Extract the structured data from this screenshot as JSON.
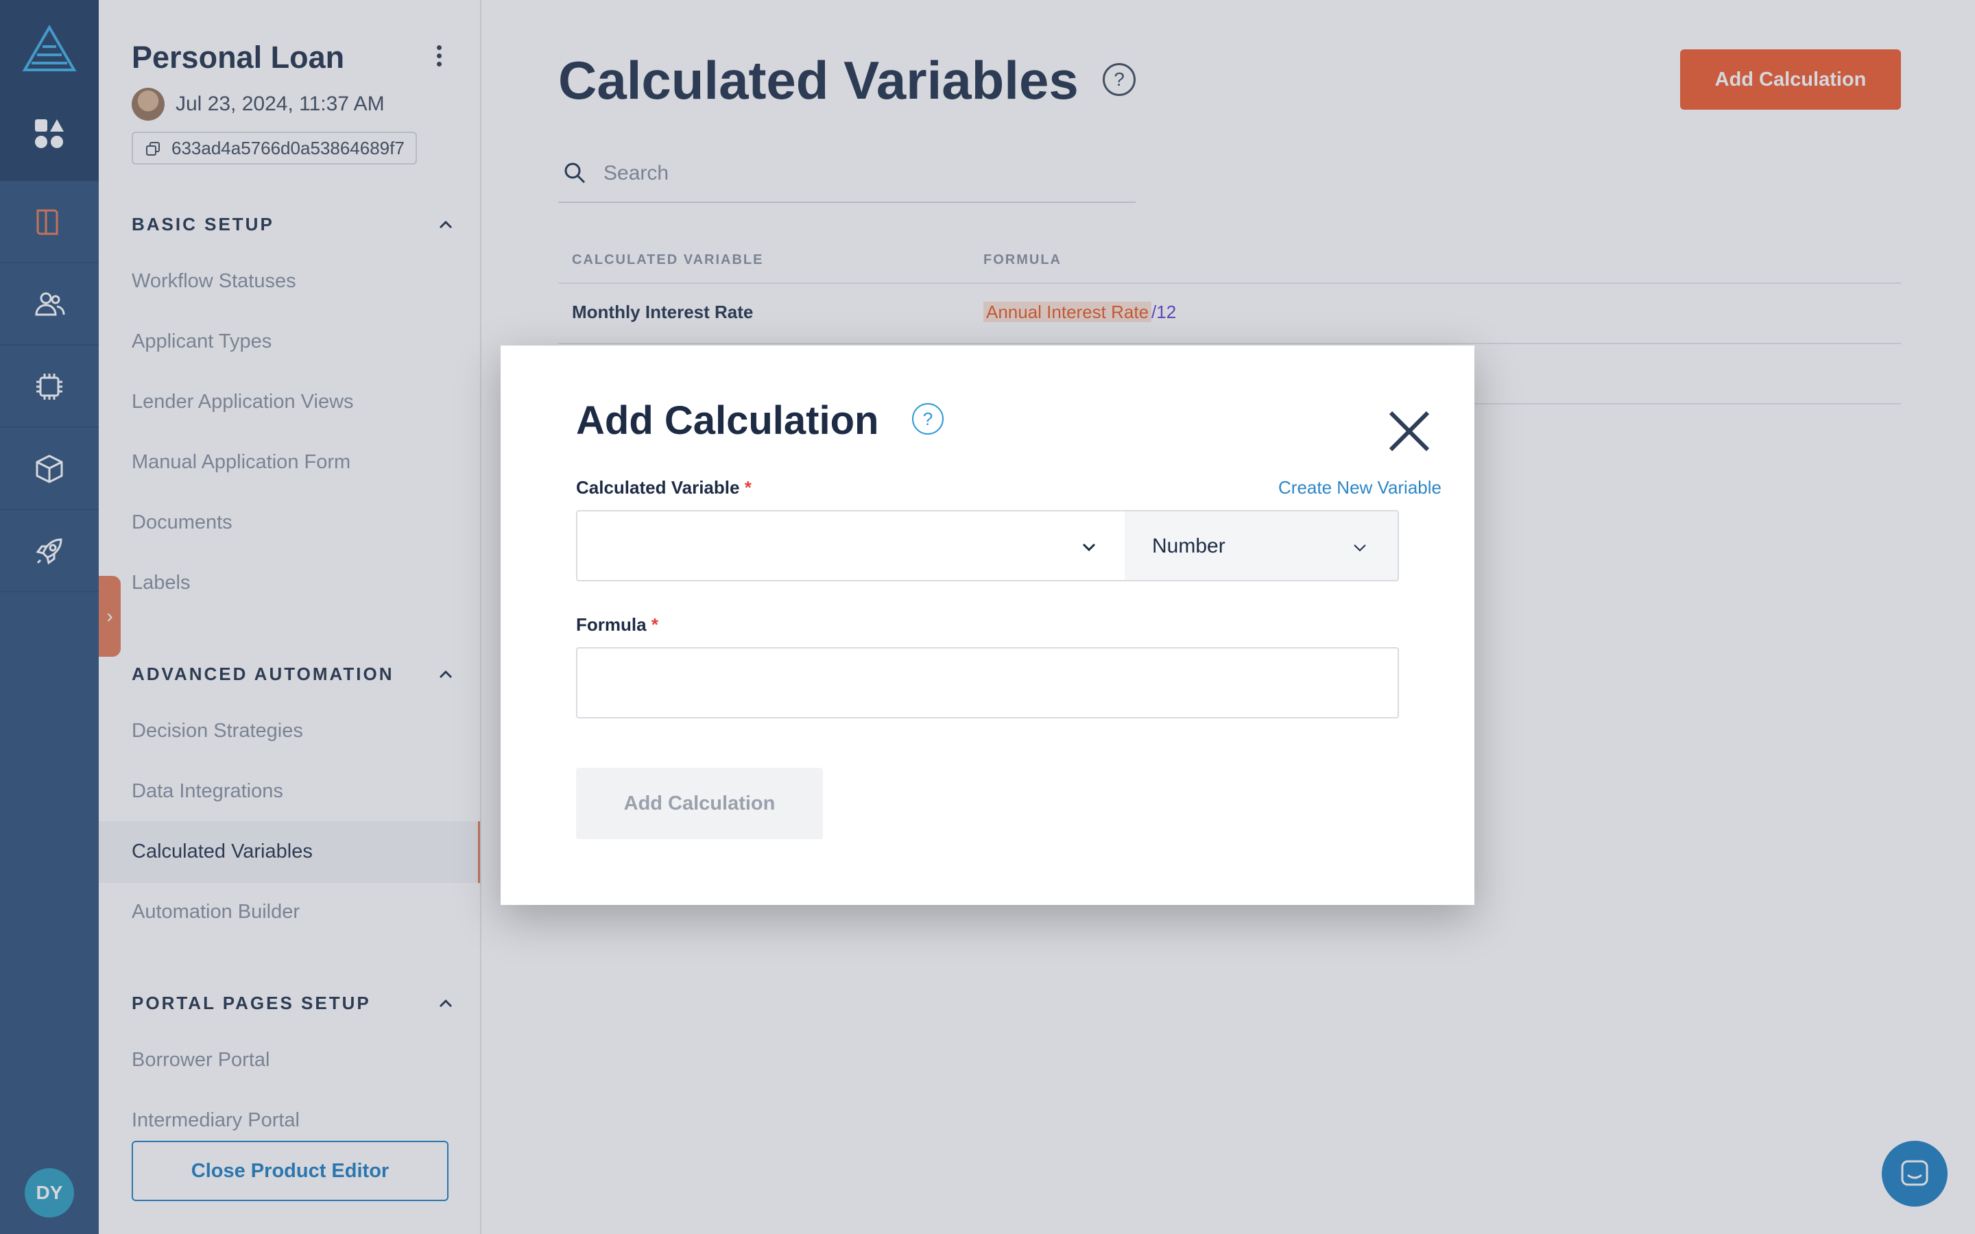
{
  "product": {
    "title": "Personal Loan",
    "date": "Jul 23, 2024, 11:37 AM",
    "id": "633ad4a5766d0a53864689f7"
  },
  "rail": {
    "avatar_initials": "DY",
    "icons": [
      "modules-icon",
      "book-icon",
      "users-icon",
      "chip-icon",
      "cube-icon",
      "rocket-icon"
    ]
  },
  "sidebar": {
    "sections": [
      {
        "title": "BASIC SETUP",
        "items": [
          "Workflow Statuses",
          "Applicant Types",
          "Lender Application Views",
          "Manual Application Form",
          "Documents",
          "Labels"
        ]
      },
      {
        "title": "ADVANCED AUTOMATION",
        "items": [
          "Decision Strategies",
          "Data Integrations",
          "Calculated Variables",
          "Automation Builder"
        ]
      },
      {
        "title": "PORTAL PAGES SETUP",
        "items": [
          "Borrower Portal",
          "Intermediary Portal"
        ]
      }
    ],
    "active_item": "Calculated Variables",
    "close_button": "Close Product Editor"
  },
  "main": {
    "title": "Calculated Variables",
    "help": "?",
    "add_button": "Add Calculation",
    "search_placeholder": "Search",
    "table": {
      "headers": [
        "CALCULATED VARIABLE",
        "FORMULA"
      ],
      "rows": [
        {
          "variable": "Monthly Interest Rate",
          "formula_var": "Annual Interest Rate",
          "formula_rest": "/12"
        }
      ]
    }
  },
  "modal": {
    "title": "Add Calculation",
    "help": "?",
    "variable_label": "Calculated Variable",
    "required_mark": "*",
    "create_link": "Create New Variable",
    "variable_value": "",
    "type_value": "Number",
    "formula_label": "Formula",
    "formula_value": "",
    "submit": "Add Calculation"
  },
  "colors": {
    "rail": "#3a5a82",
    "accent": "#f0643b",
    "link": "#2c86c6",
    "text_dark": "#2d3e56"
  }
}
